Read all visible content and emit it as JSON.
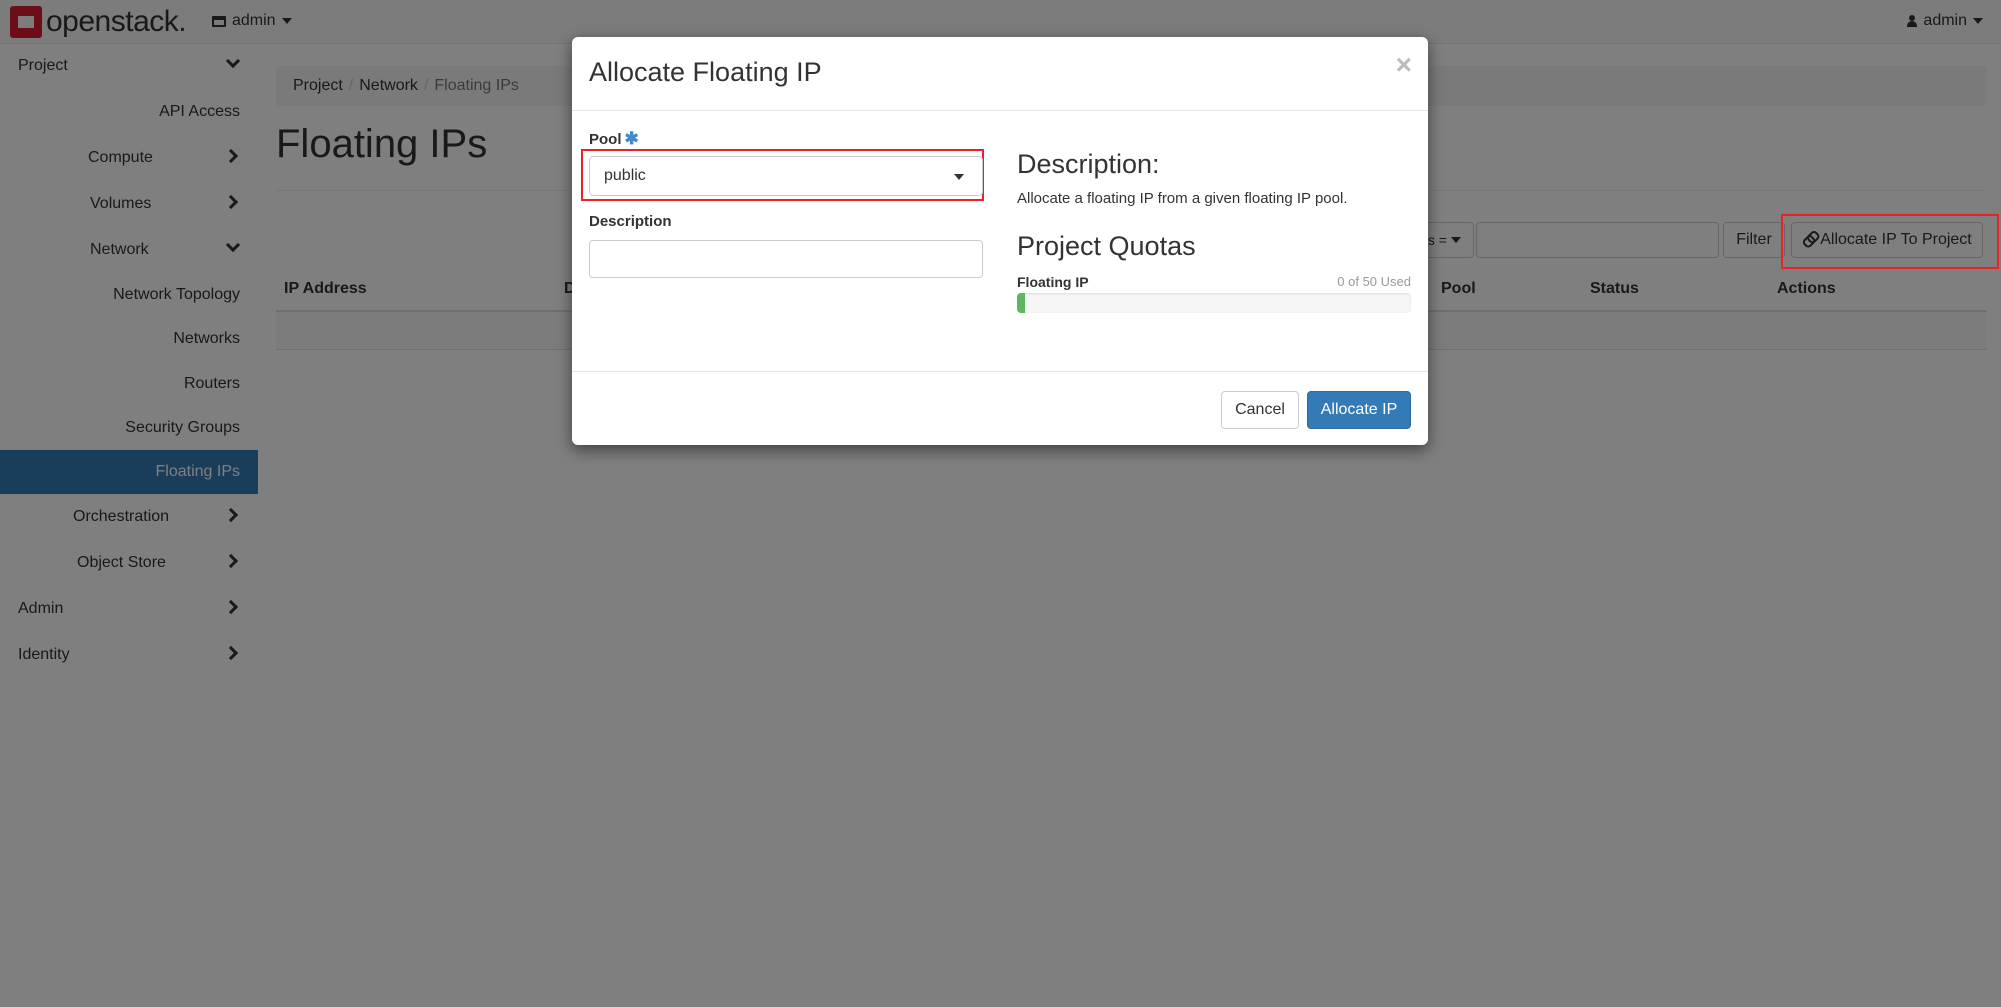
{
  "topbar": {
    "brand": "openstack.",
    "project_selector": "admin",
    "user_menu": "admin"
  },
  "sidebar": {
    "project": "Project",
    "api_access": "API Access",
    "compute": "Compute",
    "volumes": "Volumes",
    "network": "Network",
    "network_topology": "Network Topology",
    "networks": "Networks",
    "routers": "Routers",
    "security_groups": "Security Groups",
    "floating_ips": "Floating IPs",
    "orchestration": "Orchestration",
    "object_store": "Object Store",
    "admin": "Admin",
    "identity": "Identity"
  },
  "breadcrumb": {
    "items": [
      "Project",
      "Network",
      "Floating IPs"
    ]
  },
  "page": {
    "title": "Floating IPs",
    "filter_button": "Filter",
    "allocate_button": "Allocate IP To Project",
    "filter_dropdown": "s ="
  },
  "table": {
    "columns": [
      "IP Address",
      "D",
      "Pool",
      "Status",
      "Actions"
    ]
  },
  "modal": {
    "title": "Allocate Floating IP",
    "close": "×",
    "pool_label": "Pool",
    "required_marker": "✱",
    "pool_value": "public",
    "description_label": "Description",
    "description_value": "",
    "right_heading": "Description:",
    "right_text": "Allocate a floating IP from a given floating IP pool.",
    "quotas_heading": "Project Quotas",
    "quota_label": "Floating IP",
    "quota_used_text": "0 of 50 Used",
    "quota_fraction": 0.0,
    "cancel_button": "Cancel",
    "submit_button": "Allocate IP"
  },
  "colors": {
    "primary": "#337ab7",
    "highlight": "#e8212b",
    "progress": "#5cb85c",
    "brand": "#da1a32"
  }
}
